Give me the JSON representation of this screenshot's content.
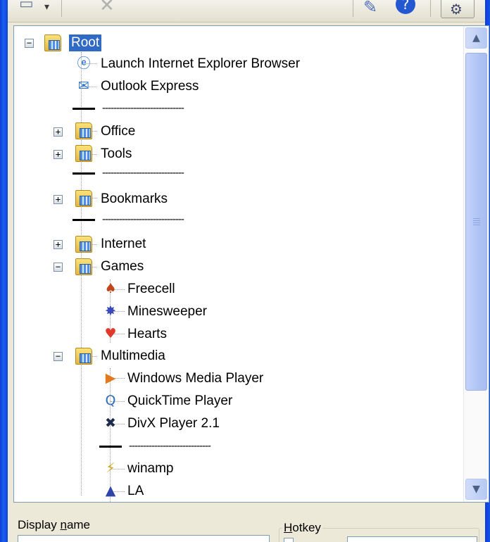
{
  "tree": {
    "root": "Root",
    "items": [
      {
        "label": "Launch Internet Explorer Browser",
        "icon": "internet-explorer-icon"
      },
      {
        "label": "Outlook Express",
        "icon": "outlook-express-icon"
      },
      {
        "label": "-----------------------------",
        "type": "separator"
      },
      {
        "label": "Office",
        "icon": "folder-icon",
        "expander": "+"
      },
      {
        "label": "Tools",
        "icon": "folder-icon",
        "expander": "+"
      },
      {
        "label": "-----------------------------",
        "type": "separator"
      },
      {
        "label": "Bookmarks",
        "icon": "folder-icon",
        "expander": "+"
      },
      {
        "label": "-----------------------------",
        "type": "separator"
      },
      {
        "label": "Internet",
        "icon": "folder-icon",
        "expander": "+"
      },
      {
        "label": "Games",
        "icon": "folder-icon",
        "expander": "−"
      },
      {
        "label": "Freecell",
        "icon": "freecell-icon"
      },
      {
        "label": "Minesweeper",
        "icon": "minesweeper-icon"
      },
      {
        "label": "Hearts",
        "icon": "hearts-icon"
      },
      {
        "label": "Multimedia",
        "icon": "folder-icon",
        "expander": "−"
      },
      {
        "label": "Windows Media Player",
        "icon": "windows-media-player-icon"
      },
      {
        "label": "QuickTime Player",
        "icon": "quicktime-icon"
      },
      {
        "label": "DivX Player 2.1",
        "icon": "divx-icon"
      },
      {
        "label": "-----------------------------",
        "type": "separator"
      },
      {
        "label": "winamp",
        "icon": "winamp-icon"
      },
      {
        "label": "LA",
        "icon": "la-icon"
      }
    ]
  },
  "bottom": {
    "display_name_pre": "Display ",
    "display_name_u": "n",
    "display_name_post": "ame",
    "hotkey_u": "H",
    "hotkey_post": "otkey"
  },
  "colors": {
    "selection": "#316ac5",
    "window_border": "#0a3fd8",
    "scrollbar_thumb": "#b8c9f4"
  }
}
